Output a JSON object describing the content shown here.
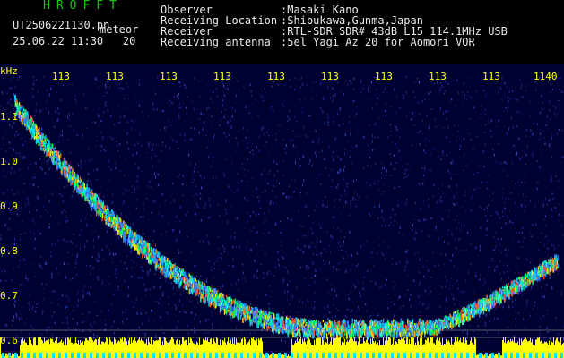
{
  "header": {
    "app_title": "HROFFT",
    "filename": "UT2506221130.pn",
    "meteor_label": "meteor",
    "date": "25.06.22",
    "time": "11:30",
    "count": "20",
    "observer_key": "Observer",
    "observer_val": ":Masaki Kano",
    "location_key": "Receiving Location",
    "location_val": ":Shibukawa,Gunma,Japan",
    "receiver_key": "Receiver",
    "receiver_val": ":RTL-SDR SDR# 43dB L15 114.1MHz USB",
    "antenna_key": "Receiving antenna",
    "antenna_val": ":5el Yagi Az 20 for Aomori VOR"
  },
  "spectrogram": {
    "y_unit": "kHz",
    "y_ticks": [
      "1.1",
      "1.0",
      "0.9",
      "0.8",
      "0.7",
      "0.6"
    ],
    "time_ticks": [
      "113",
      "113",
      "113",
      "113",
      "113",
      "113",
      "113",
      "113",
      "113",
      "1140"
    ],
    "colors": {
      "background": "#000033",
      "grid": "#b0b0b0",
      "axis_text": "#ffff00",
      "noise_bar": "#ffff00",
      "baseline": "#00e5ff"
    }
  }
}
